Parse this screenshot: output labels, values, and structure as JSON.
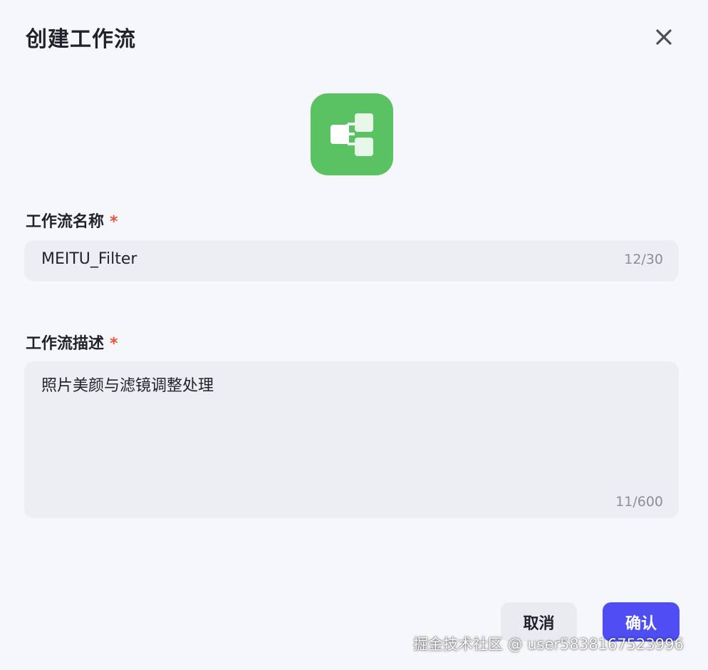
{
  "dialog": {
    "title": "创建工作流",
    "close_icon": "close-icon",
    "app_icon": "workflow-icon",
    "app_icon_color": "#5ac262"
  },
  "form": {
    "name": {
      "label": "工作流名称",
      "required_mark": "*",
      "value": "MEITU_Filter",
      "counter": "12/30"
    },
    "description": {
      "label": "工作流描述",
      "required_mark": "*",
      "value": "照片美颜与滤镜调整处理",
      "counter": "11/600"
    }
  },
  "footer": {
    "cancel_label": "取消",
    "confirm_label": "确认",
    "confirm_color": "#4e4ef2"
  },
  "watermark": "掘金技术社区 @ user5838167523996"
}
